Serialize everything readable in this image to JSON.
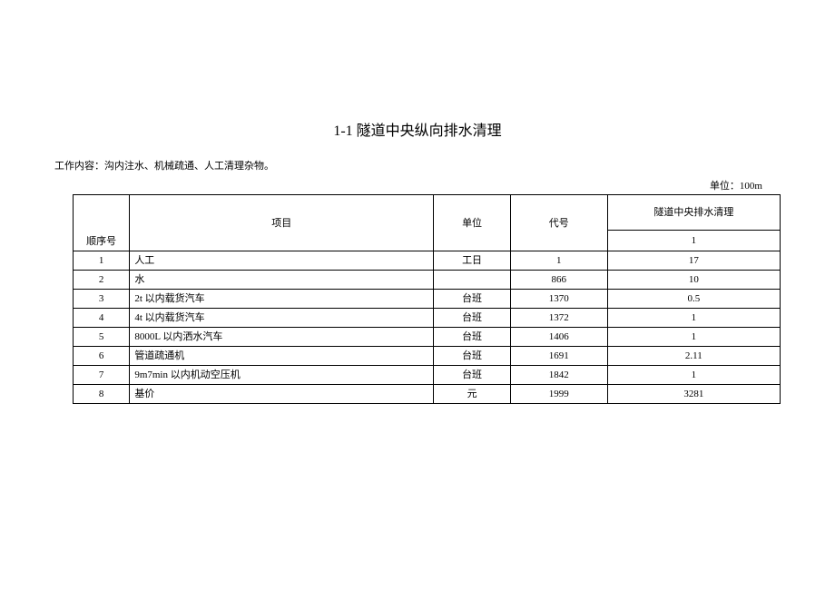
{
  "title": "1-1 隧道中央纵向排水清理",
  "subtitle": "工作内容：沟内注水、机械疏通、人工清理杂物。",
  "unit_label": "单位：100m",
  "headers": {
    "seq": "顺序号",
    "item": "项目",
    "unit": "单位",
    "code": "代号",
    "group": "隧道中央排水清理",
    "group_sub": "1"
  },
  "rows": [
    {
      "seq": "1",
      "item": "人工",
      "unit": "工日",
      "code": "1",
      "val": "17"
    },
    {
      "seq": "2",
      "item": "水",
      "unit": "",
      "code": "866",
      "val": "10"
    },
    {
      "seq": "3",
      "item": "2t 以内载货汽车",
      "unit": "台班",
      "code": "1370",
      "val": "0.5"
    },
    {
      "seq": "4",
      "item": "4t 以内载货汽车",
      "unit": "台班",
      "code": "1372",
      "val": "1"
    },
    {
      "seq": "5",
      "item": "8000L 以内洒水汽车",
      "unit": "台班",
      "code": "1406",
      "val": "1"
    },
    {
      "seq": "6",
      "item": "管道疏通机",
      "unit": "台班",
      "code": "1691",
      "val": "2.11"
    },
    {
      "seq": "7",
      "item": "9m7min 以内机动空压机",
      "unit": "台班",
      "code": "1842",
      "val": "1"
    },
    {
      "seq": "8",
      "item": "基价",
      "unit": "元",
      "code": "1999",
      "val": "3281"
    }
  ]
}
